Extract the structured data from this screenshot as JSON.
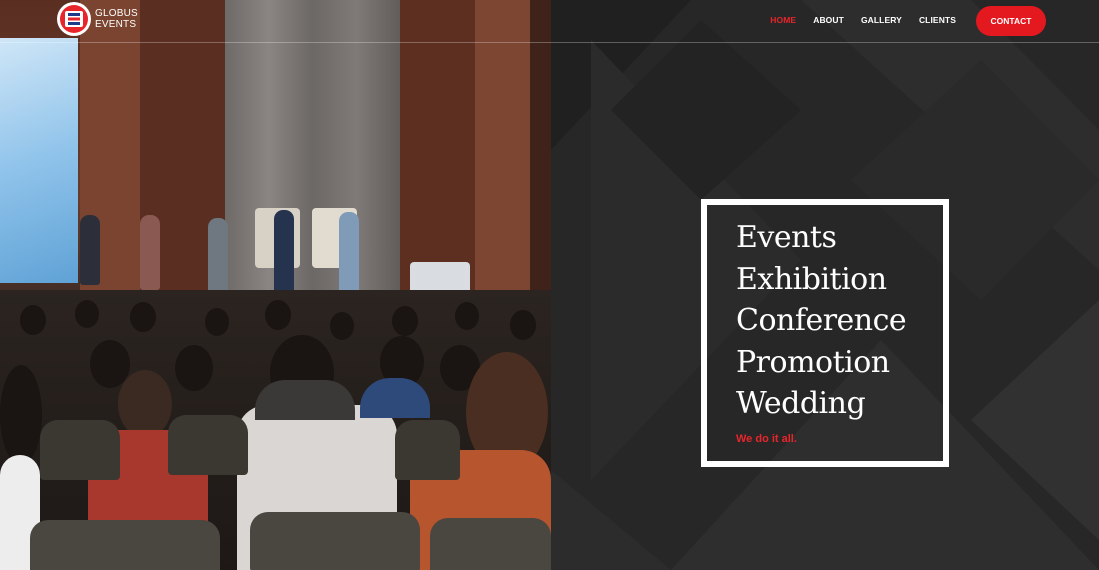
{
  "brand": {
    "line1": "GLOBUS",
    "line2": "EVENTS",
    "accent": "#e8252b"
  },
  "nav": {
    "items": [
      {
        "label": "HOME",
        "active": true
      },
      {
        "label": "ABOUT",
        "active": false
      },
      {
        "label": "GALLERY",
        "active": false
      },
      {
        "label": "CLIENTS",
        "active": false
      }
    ],
    "contact_label": "CONTACT"
  },
  "hero": {
    "image_icon": "conference-audience-photo",
    "items": [
      "Events",
      "Exhibition",
      "Conference",
      "Promotion",
      "Wedding"
    ],
    "tagline": "We do it all."
  },
  "colors": {
    "background": "#272727",
    "accent": "#e8252b",
    "button": "#e4181f",
    "text": "#ffffff"
  }
}
